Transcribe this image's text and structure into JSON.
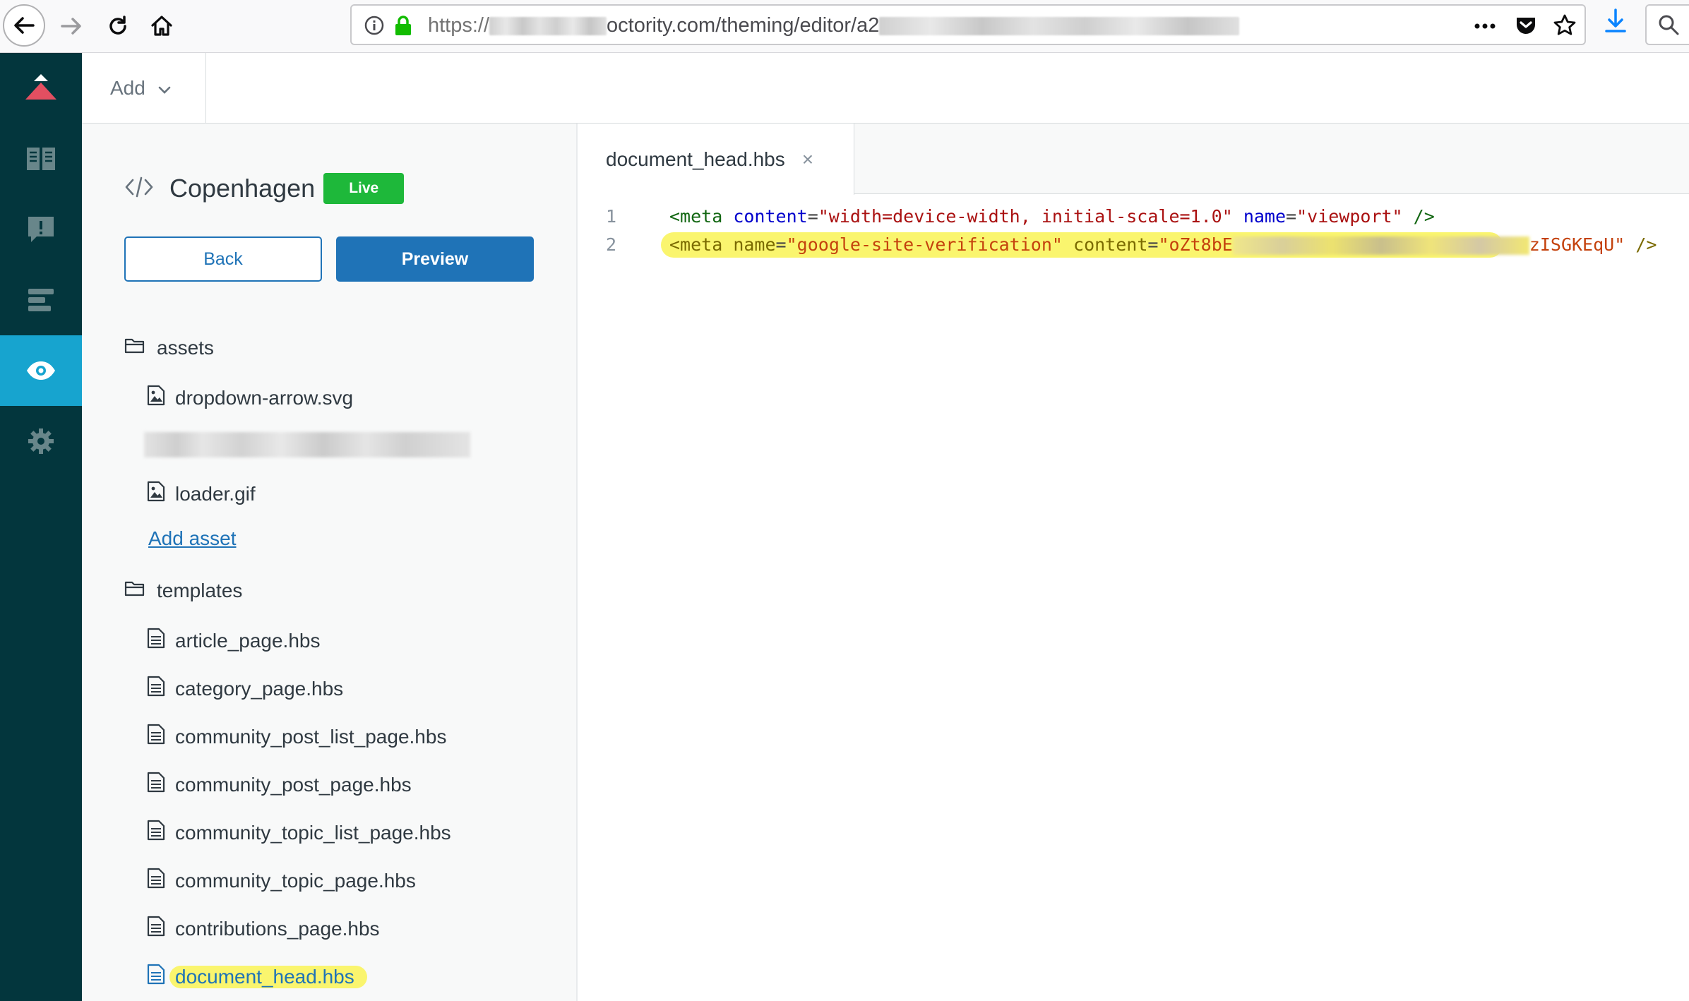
{
  "browser": {
    "url_prefix": "https://",
    "url_domain": "octority.com/theming/editor/a2"
  },
  "header": {
    "add_label": "Add"
  },
  "theme": {
    "name": "Copenhagen",
    "status_badge": "Live",
    "back_label": "Back",
    "preview_label": "Preview"
  },
  "tree": {
    "assets_folder": "assets",
    "assets": [
      "dropdown-arrow.svg",
      "loader.gif"
    ],
    "add_asset_label": "Add asset",
    "templates_folder": "templates",
    "templates": [
      "article_page.hbs",
      "category_page.hbs",
      "community_post_list_page.hbs",
      "community_post_page.hbs",
      "community_topic_list_page.hbs",
      "community_topic_page.hbs",
      "contributions_page.hbs",
      "document_head.hbs"
    ],
    "selected_template": "document_head.hbs"
  },
  "editor": {
    "tab_label": "document_head.hbs",
    "tab_close": "×",
    "lines": [
      {
        "num": "1",
        "t1": "<meta",
        "a1": "content",
        "s1": "\"width=device-width, initial-scale=1.0\"",
        "a2": "name",
        "s2": "\"viewport\"",
        "t2": "/>"
      },
      {
        "num": "2",
        "t1": "<meta",
        "a1": "name",
        "s1": "\"google-site-verification\"",
        "a2": "content",
        "s2_start": "\"oZt8bE",
        "s2_end": "zISGKEqU\"",
        "t2": "/>"
      }
    ]
  },
  "colors": {
    "rail_bg": "#03363d",
    "rail_active": "#17a4cf",
    "primary": "#1f73b7",
    "live_green": "#1eb83a",
    "highlight": "#faf56e"
  }
}
